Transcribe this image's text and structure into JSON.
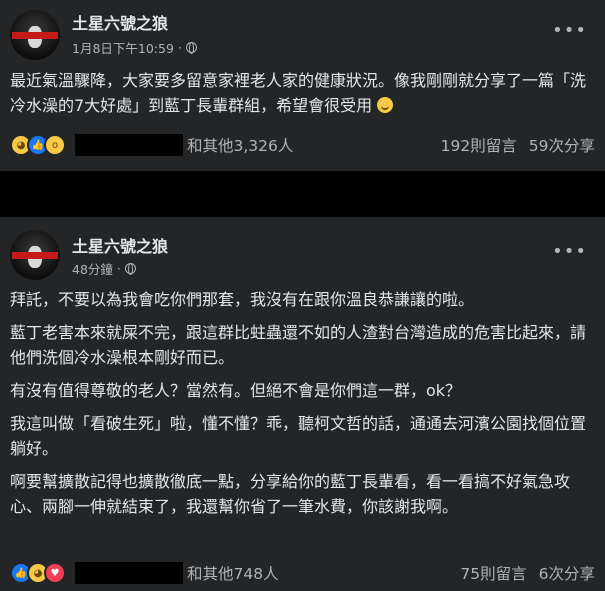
{
  "post1": {
    "author": "土星六號之狼",
    "timestamp": "1月8日下午10:59",
    "separator": "·",
    "menu": "•••",
    "body": "最近氣溫驟降，大家要多留意家裡老人家的健康狀況。像我剛剛就分享了一篇「洗冷水澡的7大好處」到藍丁長輩群組，希望會很受用",
    "reactions_text": "和其他3,326人",
    "comments": "192則留言",
    "shares": "59次分享"
  },
  "post2": {
    "author": "土星六號之狼",
    "timestamp": "48分鐘",
    "separator": "·",
    "menu": "•••",
    "paragraphs": [
      "拜託，不要以為我會吃你們那套，我沒有在跟你溫良恭謙讓的啦。",
      "藍丁老害本來就屎不完，跟這群比蛀蟲還不如的人渣對台灣造成的危害比起來，請他們洗個冷水澡根本剛好而已。",
      "有沒有值得尊敬的老人？當然有。但絕不會是你們這一群，ok？",
      "我這叫做「看破生死」啦，懂不懂？乖，聽柯文哲的話，通通去河濱公園找個位置躺好。",
      "啊要幫擴散記得也擴散徹底一點，分享給你的藍丁長輩看，看一看搞不好氣急攻心、兩腳一伸就結束了，我還幫你省了一筆水費，你該謝我啊。"
    ],
    "reactions_text": "和其他748人",
    "comments": "75則留言",
    "shares": "6次分享"
  },
  "icons": {
    "haha": "haha-reaction-icon",
    "like": "like-reaction-icon",
    "wow": "wow-reaction-icon",
    "love": "love-reaction-icon",
    "privacy": "globe-icon",
    "smile": "smile-emoji-icon"
  },
  "colors": {
    "card": "#242526",
    "text": "#e4e6eb",
    "secondary": "#b0b3b8",
    "like_blue": "#1877f2",
    "love_red": "#f33e58",
    "emoji_yellow": "#f7c948"
  }
}
